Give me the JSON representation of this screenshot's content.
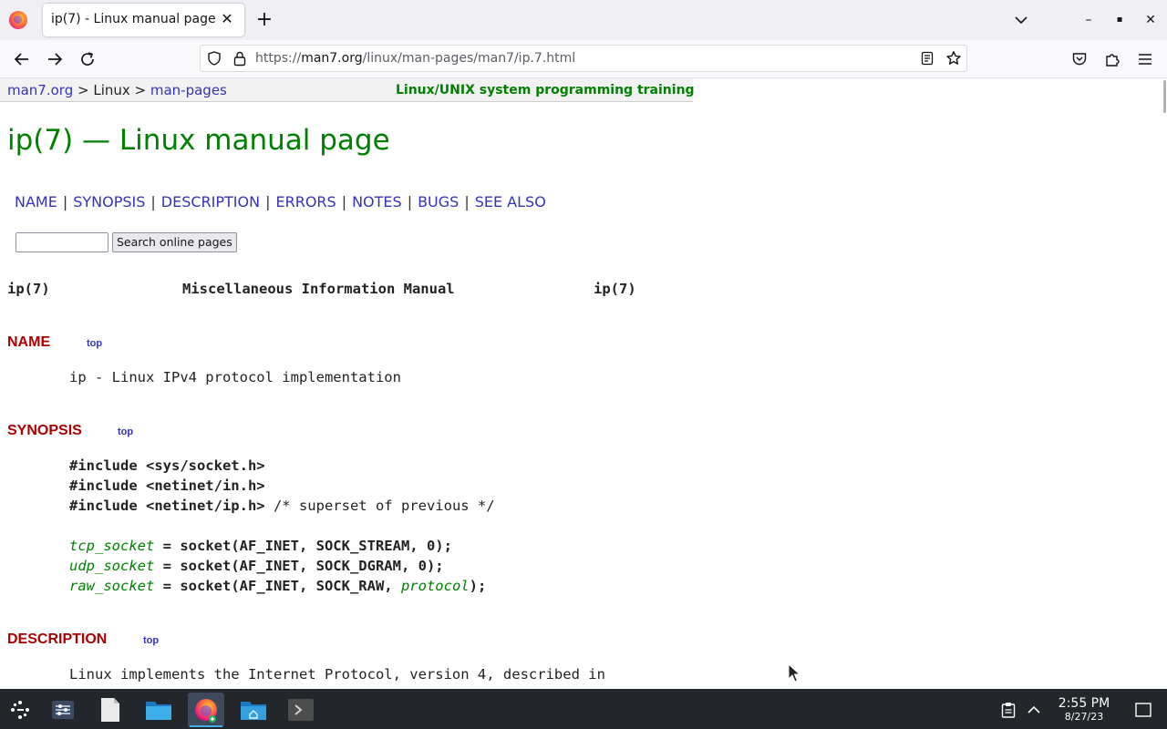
{
  "browser": {
    "tab_title": "ip(7) - Linux manual page",
    "tab_close": "✕",
    "new_tab": "+",
    "url_prefix": "https://",
    "url_host": "man7.org",
    "url_path": "/linux/man-pages/man7/ip.7.html",
    "window_buttons": {
      "minimize": "–",
      "maximize": "▪",
      "close": "✕"
    }
  },
  "page": {
    "breadcrumb": {
      "site": "man7.org",
      "sep1": " > ",
      "linux": "Linux",
      "sep2": " > ",
      "man_pages": "man-pages"
    },
    "training": "Linux/UNIX system programming training",
    "title": "ip(7) — Linux manual page",
    "section_links": [
      "NAME",
      "SYNOPSIS",
      "DESCRIPTION",
      "ERRORS",
      "NOTES",
      "BUGS",
      "SEE ALSO"
    ],
    "section_sep": "|",
    "search_button": "Search online pages",
    "header": {
      "left": "ip(7)",
      "center": "Miscellaneous Information Manual",
      "right": "ip(7)"
    },
    "name_heading": "NAME",
    "top_link": "top",
    "name_text": "ip - Linux IPv4 protocol implementation",
    "synopsis_heading": "SYNOPSIS",
    "includes": [
      {
        "directive": "#include <sys/socket.h>",
        "comment": ""
      },
      {
        "directive": "#include <netinet/in.h>",
        "comment": ""
      },
      {
        "directive": "#include <netinet/ip.h>",
        "comment": " /* superset of previous */"
      }
    ],
    "socket_lines": [
      {
        "var": "tcp_socket",
        "eq": " = ",
        "call": "socket(AF_INET, SOCK_STREAM, 0);",
        "arg": "",
        "tail": ""
      },
      {
        "var": "udp_socket",
        "eq": " = ",
        "call": "socket(AF_INET, SOCK_DGRAM, 0);",
        "arg": "",
        "tail": ""
      },
      {
        "var": "raw_socket",
        "eq": " = ",
        "call": "socket(AF_INET, SOCK_RAW, ",
        "arg": "protocol",
        "tail": ");"
      }
    ],
    "description_heading": "DESCRIPTION",
    "description_line1": "Linux implements the Internet Protocol, version 4, described in"
  },
  "taskbar": {
    "time": "2:55 PM",
    "date": "8/27/23"
  },
  "colors": {
    "title_green": "#008000",
    "link_blue": "#3333bb",
    "heading_red": "#aa0000",
    "taskbar_bg": "#23262b"
  }
}
